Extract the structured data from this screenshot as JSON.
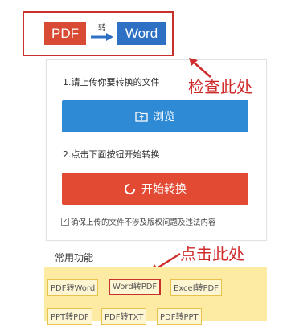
{
  "header": {
    "from_format": "PDF",
    "to_format": "Word",
    "connector_text": "转"
  },
  "upload": {
    "step1_text": "1.请上传你要转换的文件",
    "browse_label": "浏览",
    "step2_text": "2.点击下面按钮开始转换",
    "start_label": "开始转换",
    "consent_text": "确保上传的文件不涉及版权问题及违法内容",
    "consent_checked": true
  },
  "annotations": {
    "check_here": "检查此处",
    "click_here": "点击此处"
  },
  "common": {
    "title": "常用功能",
    "items": [
      {
        "label": "PDF转Word",
        "selected": false
      },
      {
        "label": "Word转PDF",
        "selected": true
      },
      {
        "label": "Excel转PDF",
        "selected": false
      },
      {
        "label": "PPT转PDF",
        "selected": false
      },
      {
        "label": "PDF转TXT",
        "selected": false
      },
      {
        "label": "PDF转PPT",
        "selected": false
      }
    ]
  },
  "colors": {
    "accent_red": "#e24a33",
    "accent_blue": "#2f8ad6",
    "annotation_red": "#d02b2b",
    "panel_yellow": "#fdeaa3"
  },
  "icons": [
    "folder-upload-icon",
    "spinner-icon",
    "arrow-right-icon",
    "checkbox-icon"
  ]
}
